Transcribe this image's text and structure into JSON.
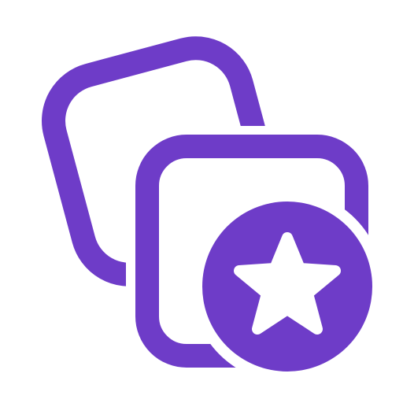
{
  "icon": {
    "name": "favorite-collection-icon",
    "parts": [
      "back-card-outline",
      "front-card-outline",
      "star-badge"
    ]
  },
  "colors": {
    "primary": "#6E3CC8",
    "background": "#FFFFFF",
    "star_fill": "#FFFFFF"
  }
}
